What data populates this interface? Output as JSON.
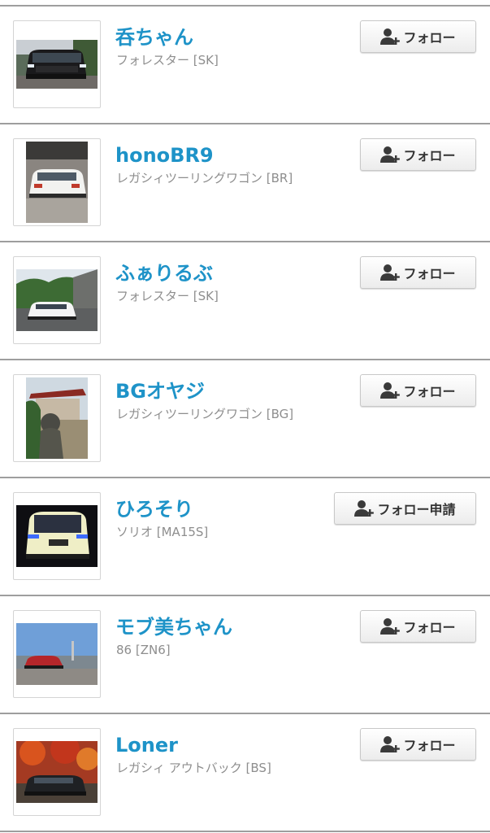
{
  "users": [
    {
      "name": "呑ちゃん",
      "car": "フォレスター [SK]",
      "follow_label": "フォロー",
      "avatar_icon": "car-photo-icon"
    },
    {
      "name": "honoBR9",
      "car": "レガシィツーリングワゴン [BR]",
      "follow_label": "フォロー",
      "avatar_icon": "car-photo-icon"
    },
    {
      "name": "ふぁりるぶ",
      "car": "フォレスター [SK]",
      "follow_label": "フォロー",
      "avatar_icon": "car-photo-icon"
    },
    {
      "name": "BGオヤジ",
      "car": "レガシィツーリングワゴン [BG]",
      "follow_label": "フォロー",
      "avatar_icon": "shrine-photo-icon"
    },
    {
      "name": "ひろそり",
      "car": "ソリオ [MA15S]",
      "follow_label": "フォロー申請",
      "avatar_icon": "car-photo-icon"
    },
    {
      "name": "モブ美ちゃん",
      "car": "86 [ZN6]",
      "follow_label": "フォロー",
      "avatar_icon": "car-photo-icon"
    },
    {
      "name": "Loner",
      "car": "レガシィ アウトバック [BS]",
      "follow_label": "フォロー",
      "avatar_icon": "car-photo-icon"
    }
  ],
  "colors": {
    "name_link": "#1e93c8",
    "car_text": "#8e8e8e",
    "divider": "#9e9e9e"
  }
}
